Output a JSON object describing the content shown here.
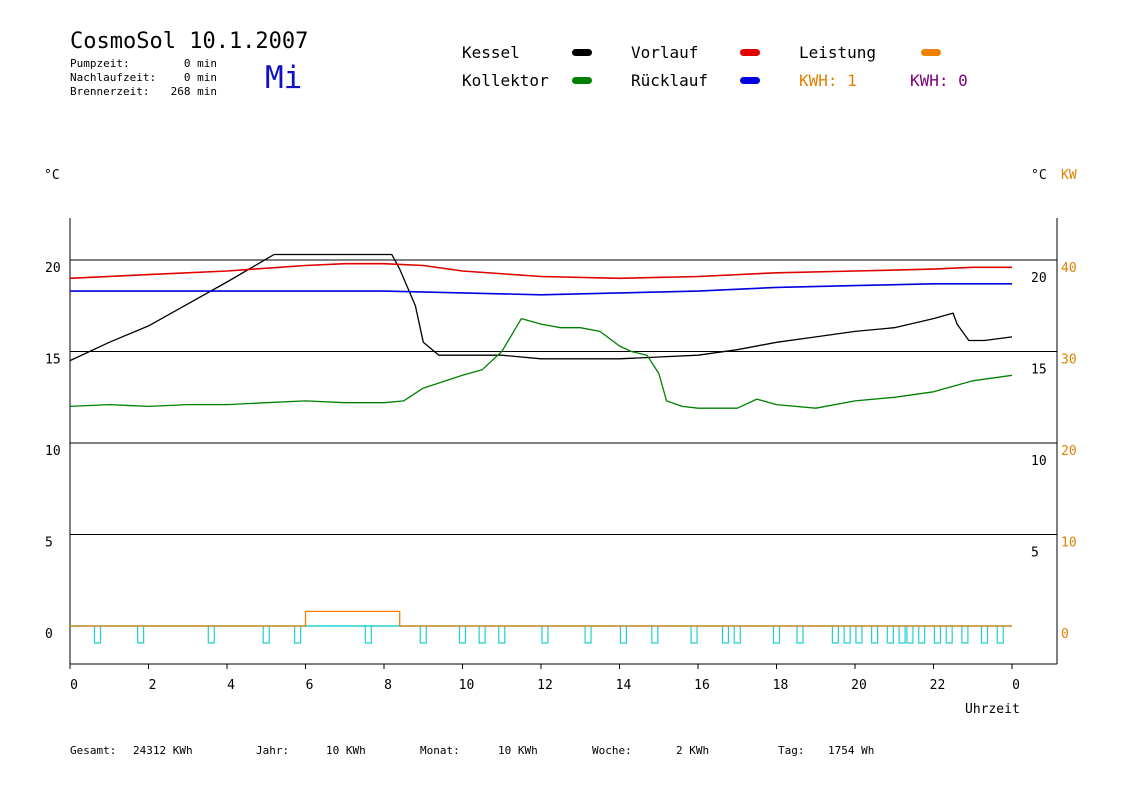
{
  "header": {
    "title": "CosmoSol 10.1.2007",
    "day": "Mi",
    "stats": [
      {
        "label": "Pumpzeit:",
        "value": "0 min"
      },
      {
        "label": "Nachlaufzeit:",
        "value": "0 min"
      },
      {
        "label": "Brennerzeit:",
        "value": "268 min"
      }
    ]
  },
  "legend": {
    "kessel": "Kessel",
    "kollektor": "Kollektor",
    "vorlauf": "Vorlauf",
    "ruecklauf": "Rücklauf",
    "leistung": "Leistung",
    "kwh_orange": "KWH: 1",
    "kwh_purple": "KWH: 0",
    "colors": {
      "kessel": "#000000",
      "kollektor": "#008000",
      "vorlauf": "#e00000",
      "ruecklauf": "#0000e0",
      "leistung": "#f08000",
      "kwh_orange": "#e08000",
      "kwh_purple": "#800080",
      "pump": "#20d0d0"
    }
  },
  "axes": {
    "left_unit": "°C",
    "right_unit_c": "°C",
    "right_unit_kw": "KW",
    "xlabel": "Uhrzeit"
  },
  "footer": {
    "gesamt_label": "Gesamt:",
    "gesamt_value": "24312 KWh",
    "jahr_label": "Jahr:",
    "jahr_value": "10 KWh",
    "monat_label": "Monat:",
    "monat_value": "10 KWh",
    "woche_label": "Woche:",
    "woche_value": "2 KWh",
    "tag_label": "Tag:",
    "tag_value": "1754 Wh"
  },
  "chart_data": {
    "type": "line",
    "xlim": [
      0,
      24
    ],
    "x_ticks": [
      0,
      2,
      4,
      6,
      8,
      10,
      12,
      14,
      16,
      18,
      20,
      22,
      24
    ],
    "x_tick_labels": [
      "0",
      "2",
      "4",
      "6",
      "8",
      "10",
      "12",
      "14",
      "16",
      "18",
      "20",
      "22",
      "0"
    ],
    "y_left": {
      "ylim": [
        -2,
        22
      ],
      "ticks": [
        0,
        5,
        10,
        15,
        20
      ]
    },
    "y_right_c": {
      "ticks": [
        5,
        10,
        15,
        20
      ],
      "note": "labels drawn with small offset below gridlines"
    },
    "y_right_kw": {
      "ticks": [
        0,
        10,
        20,
        30,
        40
      ]
    },
    "grid": "horizontal at 0,5,10,15,20",
    "series": [
      {
        "name": "Kessel",
        "color": "#000000",
        "x": [
          0,
          1,
          2,
          3,
          4,
          5.2,
          8.2,
          8.4,
          8.8,
          9.0,
          9.4,
          10,
          11,
          12,
          13,
          14,
          15,
          16,
          17,
          18,
          19,
          20,
          21,
          22,
          22.5,
          22.6,
          22.9,
          23.3,
          24
        ],
        "y": [
          14.5,
          15.5,
          16.4,
          17.6,
          18.8,
          20.3,
          20.3,
          19.5,
          17.5,
          15.5,
          14.8,
          14.8,
          14.8,
          14.6,
          14.6,
          14.6,
          14.7,
          14.8,
          15.1,
          15.5,
          15.8,
          16.1,
          16.3,
          16.8,
          17.1,
          16.5,
          15.6,
          15.6,
          15.8
        ]
      },
      {
        "name": "Vorlauf",
        "color": "#e00000",
        "x": [
          0,
          2,
          4,
          6,
          7,
          8,
          9,
          10,
          12,
          14,
          16,
          18,
          20,
          22,
          23,
          24
        ],
        "y": [
          19.0,
          19.2,
          19.4,
          19.7,
          19.8,
          19.8,
          19.7,
          19.4,
          19.1,
          19.0,
          19.1,
          19.3,
          19.4,
          19.5,
          19.6,
          19.6
        ]
      },
      {
        "name": "Rücklauf",
        "color": "#0000e0",
        "x": [
          0,
          2,
          4,
          6,
          8,
          10,
          12,
          14,
          16,
          18,
          20,
          22,
          23,
          24
        ],
        "y": [
          18.3,
          18.3,
          18.3,
          18.3,
          18.3,
          18.2,
          18.1,
          18.2,
          18.3,
          18.5,
          18.6,
          18.7,
          18.7,
          18.7
        ]
      },
      {
        "name": "Kollektor",
        "color": "#008000",
        "x": [
          0,
          1,
          2,
          3,
          4,
          5,
          6,
          7,
          8,
          8.5,
          9,
          10,
          10.5,
          11,
          11.5,
          12,
          12.5,
          13,
          13.5,
          14,
          14.3,
          14.7,
          15,
          15.2,
          15.6,
          16,
          17,
          17.5,
          18,
          19,
          20,
          21,
          22,
          22.5,
          23,
          24
        ],
        "y": [
          12.0,
          12.1,
          12.0,
          12.1,
          12.1,
          12.2,
          12.3,
          12.2,
          12.2,
          12.3,
          13.0,
          13.7,
          14.0,
          15.0,
          16.8,
          16.5,
          16.3,
          16.3,
          16.1,
          15.3,
          15.0,
          14.8,
          13.8,
          12.3,
          12.0,
          11.9,
          11.9,
          12.4,
          12.1,
          11.9,
          12.3,
          12.5,
          12.8,
          13.1,
          13.4,
          13.7
        ]
      },
      {
        "name": "Leistung",
        "color": "#f08000",
        "x": [
          0,
          6.0,
          6.0,
          8.4,
          8.4,
          24
        ],
        "y": [
          0,
          0,
          0.8,
          0.8,
          0,
          0
        ]
      }
    ],
    "pump_pulses_hours": [
      0.7,
      1.8,
      3.6,
      5.0,
      5.8,
      7.6,
      9.0,
      10.0,
      10.5,
      11.0,
      12.1,
      13.2,
      14.1,
      14.9,
      15.9,
      16.7,
      17.0,
      18.0,
      18.6,
      19.5,
      19.8,
      20.1,
      20.5,
      20.9,
      21.2,
      21.4,
      21.7,
      22.1,
      22.4,
      22.8,
      23.3,
      23.7
    ]
  }
}
